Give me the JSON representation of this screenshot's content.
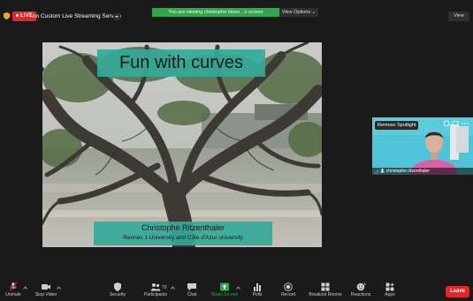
{
  "header": {
    "live_badge": "LIVE",
    "live_label": "on Custom Live Streaming Service",
    "banner": "You are viewing christophe ritzen...'s screen",
    "view_options": "View Options ⌄",
    "view_button": "View"
  },
  "slide": {
    "title": "Fun with curves",
    "author": "Christophe Ritzenthaler",
    "affiliation": "Rennes 1 University and Côte d'Azur university"
  },
  "spotlight": {
    "remove_label": "Remove Spotlight",
    "name": "christophe ritzenthaler"
  },
  "toolbar": {
    "items": [
      {
        "label": "Unmute",
        "icon": "mic-muted-icon"
      },
      {
        "label": "Stop Video",
        "icon": "video-camera-icon"
      },
      {
        "label": "Security",
        "icon": "shield-icon"
      },
      {
        "label": "Participants",
        "icon": "people-icon",
        "count": "70"
      },
      {
        "label": "Chat",
        "icon": "chat-icon"
      },
      {
        "label": "Share Screen",
        "icon": "share-screen-icon"
      },
      {
        "label": "Polls",
        "icon": "polls-icon"
      },
      {
        "label": "Record",
        "icon": "record-icon"
      },
      {
        "label": "Breakout Rooms",
        "icon": "breakout-rooms-icon"
      },
      {
        "label": "Reactions",
        "icon": "reactions-icon"
      },
      {
        "label": "Apps",
        "icon": "apps-icon"
      }
    ],
    "leave_label": "Leave"
  },
  "colors": {
    "background": "#1a1a1a",
    "accent_green": "#2ea84b",
    "live_red": "#e02828",
    "slide_teal": "#34a998",
    "thumb_cyan": "#4fc3d8"
  }
}
